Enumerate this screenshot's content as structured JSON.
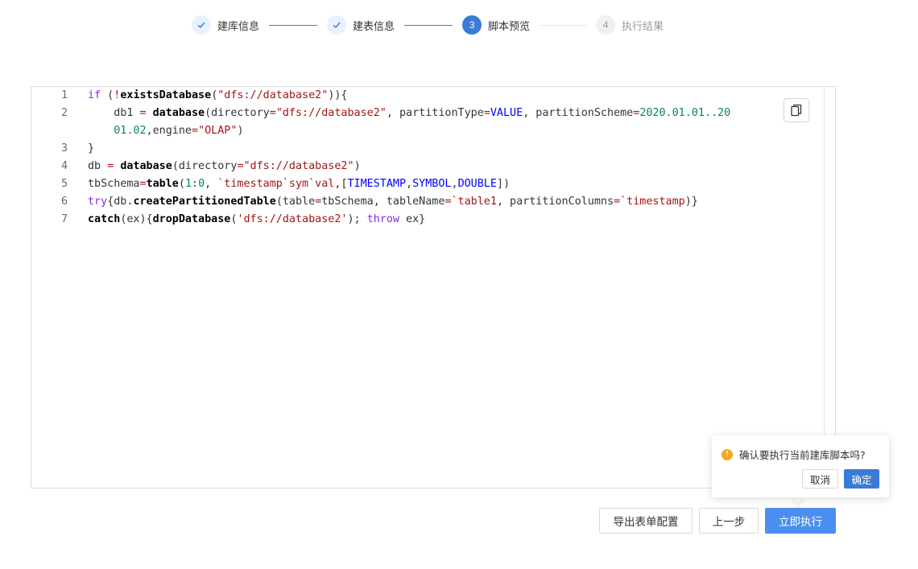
{
  "steps": [
    {
      "index": "1",
      "label": "建库信息",
      "state": "done"
    },
    {
      "index": "2",
      "label": "建表信息",
      "state": "done"
    },
    {
      "index": "3",
      "label": "脚本预览",
      "state": "active"
    },
    {
      "index": "4",
      "label": "执行结果",
      "state": "pending"
    }
  ],
  "editor": {
    "line_numbers": [
      "1",
      "2",
      "3",
      "4",
      "5",
      "6",
      "7"
    ],
    "copy_icon": "copy-icon"
  },
  "popconfirm": {
    "icon": "warning-icon",
    "icon_glyph": "!",
    "message": "确认要执行当前建库脚本吗?",
    "cancel_label": "取消",
    "ok_label": "确定"
  },
  "footer": {
    "export_label": "导出表单配置",
    "prev_label": "上一步",
    "run_label": "立即执行"
  },
  "colors": {
    "primary": "#3a7bd5",
    "run_button": "#4a8ef0",
    "warning": "#f5a623"
  }
}
